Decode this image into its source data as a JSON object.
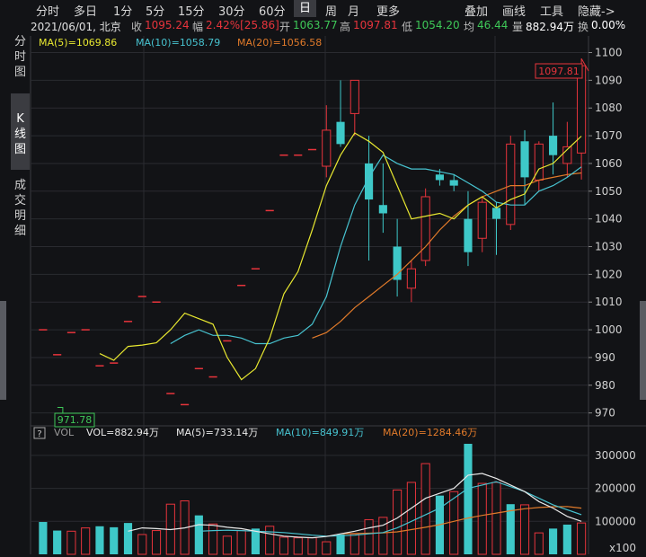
{
  "toolbar": {
    "periods": [
      "分时",
      "多日",
      "1分",
      "5分",
      "15分",
      "30分",
      "60分",
      "日",
      "周",
      "月",
      "更多"
    ],
    "active": "日",
    "tools": [
      "叠加",
      "画线",
      "工具",
      "隐藏->"
    ]
  },
  "quote": {
    "date": "2021/06/01, 北京",
    "close_label": "收",
    "close": "1095.24",
    "change_label": "幅",
    "change": "2.42%[25.86]",
    "open_label": "开",
    "open": "1063.77",
    "high_label": "高",
    "high": "1097.81",
    "low_label": "低",
    "low": "1054.20",
    "avg_label": "均",
    "avg": "46.44",
    "volume_label": "量",
    "volume": "882.94万",
    "turnover_label": "换",
    "turnover": "0.00%"
  },
  "sidebar": {
    "items": [
      {
        "label": "分时图",
        "active": false
      },
      {
        "label": "K线图",
        "active": true
      },
      {
        "label": "成交明细",
        "active": false
      }
    ]
  },
  "colors": {
    "up": "#e8343c",
    "down": "#3ec8c8",
    "ma5": "#e8e830",
    "ma10": "#47c3d0",
    "ma20": "#e07a2a",
    "vol": "#e8e8e8",
    "grid": "#2a2b30"
  },
  "chart_data": [
    {
      "type": "candlestick",
      "title": "",
      "legend": [
        {
          "name": "MA(5)",
          "value": "1069.86",
          "color": "#e8e830"
        },
        {
          "name": "MA(10)",
          "value": "1058.79",
          "color": "#47c3d0"
        },
        {
          "name": "MA(20)",
          "value": "1056.58",
          "color": "#e07a2a"
        }
      ],
      "ylim": [
        966,
        1106
      ],
      "yticks": [
        970,
        980,
        990,
        1000,
        1010,
        1020,
        1030,
        1040,
        1050,
        1060,
        1070,
        1080,
        1090,
        1100
      ],
      "high_marker": "1097.81",
      "low_marker": "971.78",
      "candles": [
        {
          "o": 1000,
          "h": 1000,
          "l": 1000,
          "c": 1000
        },
        {
          "o": 991,
          "h": 991,
          "l": 991,
          "c": 991
        },
        {
          "o": 999,
          "h": 999,
          "l": 999,
          "c": 999
        },
        {
          "o": 1000,
          "h": 1000,
          "l": 1000,
          "c": 1000
        },
        {
          "o": 987,
          "h": 987,
          "l": 987,
          "c": 987
        },
        {
          "o": 988,
          "h": 988,
          "l": 988,
          "c": 988
        },
        {
          "o": 1003,
          "h": 1003,
          "l": 1003,
          "c": 1003
        },
        {
          "o": 1012,
          "h": 1012,
          "l": 1012,
          "c": 1012
        },
        {
          "o": 1010,
          "h": 1010,
          "l": 1010,
          "c": 1010
        },
        {
          "o": 977,
          "h": 977,
          "l": 977,
          "c": 977
        },
        {
          "o": 973,
          "h": 973,
          "l": 973,
          "c": 973
        },
        {
          "o": 986,
          "h": 986,
          "l": 986,
          "c": 986
        },
        {
          "o": 983,
          "h": 983,
          "l": 983,
          "c": 983
        },
        {
          "o": 996,
          "h": 996,
          "l": 996,
          "c": 996
        },
        {
          "o": 1016,
          "h": 1016,
          "l": 1016,
          "c": 1016
        },
        {
          "o": 1022,
          "h": 1022,
          "l": 1022,
          "c": 1022
        },
        {
          "o": 1043,
          "h": 1043,
          "l": 1043,
          "c": 1043
        },
        {
          "o": 1063,
          "h": 1063,
          "l": 1063,
          "c": 1063
        },
        {
          "o": 1063,
          "h": 1063,
          "l": 1063,
          "c": 1063
        },
        {
          "o": 1065,
          "h": 1065,
          "l": 1065,
          "c": 1065
        },
        {
          "o": 1059,
          "h": 1081,
          "l": 1055,
          "c": 1072
        },
        {
          "o": 1075,
          "h": 1090,
          "l": 1066,
          "c": 1067
        },
        {
          "o": 1078,
          "h": 1090,
          "l": 1070,
          "c": 1090
        },
        {
          "o": 1060,
          "h": 1070,
          "l": 1025,
          "c": 1047
        },
        {
          "o": 1045,
          "h": 1060,
          "l": 1035,
          "c": 1042
        },
        {
          "o": 1030,
          "h": 1040,
          "l": 1012,
          "c": 1018
        },
        {
          "o": 1015,
          "h": 1025,
          "l": 1010,
          "c": 1022
        },
        {
          "o": 1025,
          "h": 1051,
          "l": 1023,
          "c": 1048
        },
        {
          "o": 1056,
          "h": 1058,
          "l": 1052,
          "c": 1054
        },
        {
          "o": 1054,
          "h": 1056,
          "l": 1050,
          "c": 1052
        },
        {
          "o": 1040,
          "h": 1050,
          "l": 1023,
          "c": 1028
        },
        {
          "o": 1033,
          "h": 1048,
          "l": 1028,
          "c": 1046
        },
        {
          "o": 1044,
          "h": 1046,
          "l": 1027,
          "c": 1040
        },
        {
          "o": 1038,
          "h": 1070,
          "l": 1036,
          "c": 1067
        },
        {
          "o": 1068,
          "h": 1072,
          "l": 1045,
          "c": 1055
        },
        {
          "o": 1054,
          "h": 1068,
          "l": 1050,
          "c": 1067
        },
        {
          "o": 1070,
          "h": 1082,
          "l": 1056,
          "c": 1063
        },
        {
          "o": 1060,
          "h": 1075,
          "l": 1055,
          "c": 1066
        },
        {
          "o": 1063.77,
          "h": 1097.81,
          "l": 1054.2,
          "c": 1095.24
        }
      ],
      "ma5": [
        null,
        null,
        null,
        null,
        991.4,
        989,
        994,
        994.5,
        995.3,
        1000,
        1006,
        1004,
        1002,
        990,
        982,
        986,
        997,
        1013,
        1021,
        1036,
        1052,
        1063,
        1071,
        1068,
        1064,
        1052,
        1040,
        1041,
        1042,
        1040,
        1045,
        1048,
        1044,
        1047,
        1049,
        1058,
        1060,
        1065,
        1069.86
      ],
      "ma10": [
        null,
        null,
        null,
        null,
        null,
        null,
        null,
        null,
        null,
        995,
        998,
        1000,
        998,
        998,
        997,
        995,
        995,
        997,
        998,
        1002,
        1012,
        1030,
        1045,
        1055,
        1063,
        1060,
        1058,
        1058,
        1057,
        1056,
        1053,
        1050,
        1046,
        1045,
        1045,
        1050,
        1052,
        1055,
        1058.79
      ],
      "ma20": [
        null,
        null,
        null,
        null,
        null,
        null,
        null,
        null,
        null,
        null,
        null,
        null,
        null,
        null,
        null,
        null,
        null,
        null,
        null,
        997,
        999,
        1003,
        1008,
        1012,
        1016,
        1020,
        1025,
        1030,
        1036,
        1041,
        1045,
        1048,
        1050,
        1052,
        1052,
        1054,
        1055,
        1056,
        1056.58
      ]
    },
    {
      "type": "bar",
      "title": "",
      "legend": [
        {
          "name": "VOL",
          "value": "882.94万",
          "color": "#e8e8e8"
        },
        {
          "name": "MA(5)",
          "value": "733.14万",
          "color": "#e8e8e8"
        },
        {
          "name": "MA(10)",
          "value": "849.91万",
          "color": "#47c3d0"
        },
        {
          "name": "MA(20)",
          "value": "1284.46万",
          "color": "#e07a2a"
        }
      ],
      "panel_label": "VOL",
      "unit": "x100",
      "ylim": [
        0,
        335000
      ],
      "yticks": [
        100000,
        200000,
        300000
      ],
      "values": [
        98000,
        72000,
        70000,
        80000,
        85000,
        82000,
        95000,
        60000,
        72000,
        152000,
        162000,
        118000,
        92000,
        55000,
        72000,
        78000,
        85000,
        52000,
        50000,
        50000,
        38000,
        60000,
        62000,
        105000,
        112000,
        195000,
        218000,
        275000,
        178000,
        190000,
        335000,
        215000,
        218000,
        152000,
        150000,
        65000,
        78000,
        90000,
        95000
      ],
      "directions": [
        "down",
        "down",
        "up",
        "up",
        "down",
        "down",
        "down",
        "up",
        "up",
        "up",
        "up",
        "down",
        "up",
        "up",
        "up",
        "down",
        "up",
        "up",
        "up",
        "up",
        "up",
        "down",
        "up",
        "up",
        "up",
        "up",
        "up",
        "up",
        "down",
        "up",
        "down",
        "up",
        "up",
        "down",
        "up",
        "up",
        "down",
        "down",
        "up"
      ],
      "vol_ma5": [
        null,
        null,
        null,
        null,
        null,
        null,
        70000,
        80000,
        78000,
        75000,
        80000,
        90000,
        88000,
        82000,
        78000,
        70000,
        62000,
        55000,
        52000,
        50000,
        54000,
        62000,
        70000,
        80000,
        88000,
        110000,
        140000,
        170000,
        185000,
        200000,
        240000,
        245000,
        230000,
        210000,
        190000,
        160000,
        140000,
        115000,
        100000
      ],
      "vol_ma10": [
        null,
        null,
        null,
        null,
        null,
        null,
        null,
        null,
        null,
        null,
        null,
        70000,
        72000,
        73000,
        72000,
        70000,
        68000,
        66000,
        62000,
        58000,
        55000,
        56000,
        58000,
        62000,
        66000,
        80000,
        100000,
        120000,
        140000,
        170000,
        200000,
        210000,
        220000,
        205000,
        190000,
        170000,
        150000,
        135000,
        120000
      ],
      "vol_ma20": [
        null,
        null,
        null,
        null,
        null,
        null,
        null,
        null,
        null,
        null,
        null,
        null,
        null,
        null,
        null,
        null,
        null,
        null,
        null,
        null,
        null,
        62000,
        63000,
        64000,
        65000,
        68000,
        75000,
        82000,
        90000,
        100000,
        110000,
        118000,
        125000,
        132000,
        138000,
        142000,
        144000,
        145000,
        140000
      ]
    }
  ]
}
